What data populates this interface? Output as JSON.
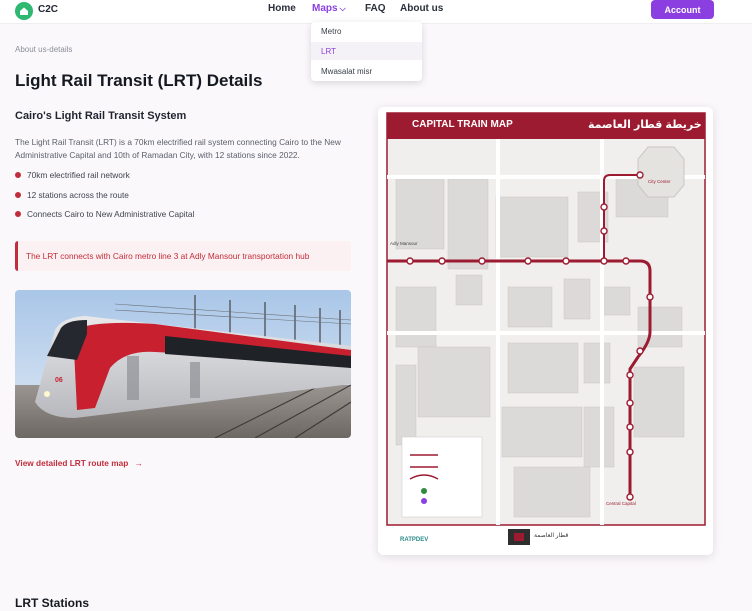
{
  "nav": {
    "brand": "C2C",
    "links": [
      "Home",
      "Maps",
      "FAQ",
      "About us"
    ],
    "account": "Account"
  },
  "dropdown": {
    "items": [
      "Metro",
      "LRT",
      "Mwasalat misr"
    ],
    "active": "LRT"
  },
  "breadcrumb": "About us-details",
  "page_title": "Light Rail Transit (LRT) Details",
  "section": {
    "title": "Cairo's Light Rail Transit System",
    "description": "The Light Rail Transit (LRT) is a 70km electrified rail system connecting Cairo to the New Administrative Capital and 10th of Ramadan City, with 12 stations since 2022.",
    "bullets": [
      "70km electrified rail network",
      "12 stations across the route",
      "Connects Cairo to New Administrative Capital"
    ],
    "callout": "The LRT connects with Cairo metro line 3 at Adly Mansour transportation hub",
    "detail_link": "View detailed LRT route map",
    "detail_arrow": "→"
  },
  "map": {
    "header_en": "CAPITAL TRAIN MAP",
    "header_ar": "خريطة قطار العاصمة",
    "station_adly": "Adly Mansour",
    "station_city_center": "City Center",
    "station_central": "Central Capital",
    "footer_left": "RATPDEV",
    "footer_center": "قطار العاصمة"
  },
  "stations_heading": "LRT Stations",
  "colors": {
    "accent": "#8b3fe0",
    "brand_red": "#c22d3b",
    "map_header": "#9c1b30",
    "logo_green": "#2eb872"
  }
}
